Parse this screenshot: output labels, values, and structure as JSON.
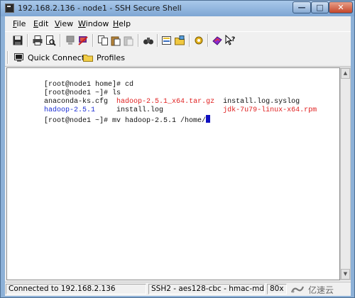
{
  "window": {
    "title": "192.168.2.136 - node1 - SSH Secure Shell",
    "controls": {
      "minimize": "—",
      "maximize": "□",
      "close": "✕"
    }
  },
  "menubar": {
    "items": [
      {
        "label": "File",
        "underline": "F",
        "rest": "ile"
      },
      {
        "label": "Edit",
        "underline": "E",
        "rest": "dit"
      },
      {
        "label": "View",
        "underline": "V",
        "rest": "iew"
      },
      {
        "label": "Window",
        "underline": "W",
        "rest": "indow"
      },
      {
        "label": "Help",
        "underline": "H",
        "rest": "elp"
      }
    ]
  },
  "toolbar": {
    "icons": [
      "save-icon",
      "print-icon",
      "print-preview-icon",
      "disconnect-icon",
      "quick-connect-icon",
      "copy-icon",
      "paste-icon",
      "paste-gray-icon",
      "find-icon",
      "sftp-icon",
      "file-transfer-icon",
      "settings-icon",
      "help-book-icon",
      "context-help-icon"
    ]
  },
  "profilebar": {
    "quick_connect": "Quick Connect",
    "profiles": "Profiles"
  },
  "terminal": {
    "lines": [
      [
        {
          "text": "[root@node1 home]# cd",
          "color": "default"
        }
      ],
      [
        {
          "text": "[root@node1 ~]# ls",
          "color": "default"
        }
      ],
      [
        {
          "text": "anaconda-ks.cfg  ",
          "color": "default"
        },
        {
          "text": "hadoop-2.5.1_x64.tar.gz",
          "color": "red"
        },
        {
          "text": "  install.log.syslog",
          "color": "default"
        }
      ],
      [
        {
          "text": "hadoop-2.5.1",
          "color": "blue"
        },
        {
          "text": "     install.log              ",
          "color": "default"
        },
        {
          "text": "jdk-7u79-linux-x64.rpm",
          "color": "red"
        }
      ],
      [
        {
          "text": "[root@node1 ~]# mv hadoop-2.5.1 /home/",
          "color": "default"
        }
      ]
    ],
    "colors": {
      "default": "#111111",
      "blue": "#1c2fd6",
      "red": "#e02020",
      "cursor": "#1010c0"
    }
  },
  "statusbar": {
    "connection": "Connected to 192.168.2.136",
    "cipher": "SSH2 - aes128-cbc - hmac-md5",
    "size": "80x"
  },
  "watermark": {
    "text": "亿速云"
  }
}
